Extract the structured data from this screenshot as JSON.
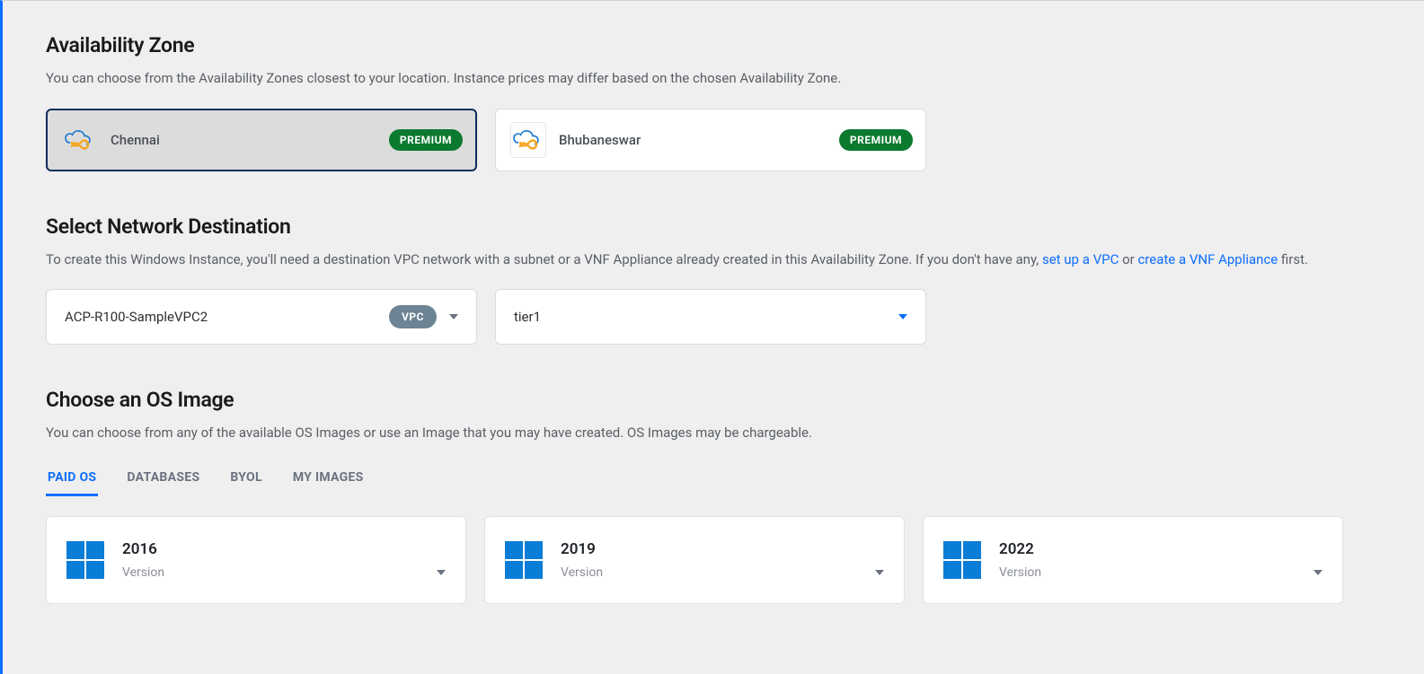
{
  "availability_zone": {
    "title": "Availability Zone",
    "description": "You can choose from the Availability Zones closest to your location. Instance prices may differ based on the chosen Availability Zone.",
    "zones": [
      {
        "name": "Chennai",
        "badge": "PREMIUM",
        "selected": true
      },
      {
        "name": "Bhubaneswar",
        "badge": "PREMIUM",
        "selected": false
      }
    ]
  },
  "network": {
    "title": "Select Network Destination",
    "desc_prefix": "To create this Windows Instance, you'll need a destination VPC network with a subnet or a VNF Appliance already created in this Availability Zone. If you don't have any, ",
    "link_vpc": "set up a VPC",
    "desc_or": " or ",
    "link_vnf": "create a VNF Appliance",
    "desc_suffix": " first.",
    "vpc_select": {
      "value": "ACP-R100-SampleVPC2",
      "pill": "VPC"
    },
    "tier_select": {
      "value": "tier1"
    }
  },
  "os": {
    "title": "Choose an OS Image",
    "description": "You can choose from any of the available OS Images or use an Image that you may have created. OS Images may be chargeable.",
    "tabs": [
      {
        "label": "PAID OS",
        "active": true
      },
      {
        "label": "DATABASES",
        "active": false
      },
      {
        "label": "BYOL",
        "active": false
      },
      {
        "label": "MY IMAGES",
        "active": false
      }
    ],
    "images": [
      {
        "name": "2016",
        "version_label": "Version"
      },
      {
        "name": "2019",
        "version_label": "Version"
      },
      {
        "name": "2022",
        "version_label": "Version"
      }
    ]
  }
}
